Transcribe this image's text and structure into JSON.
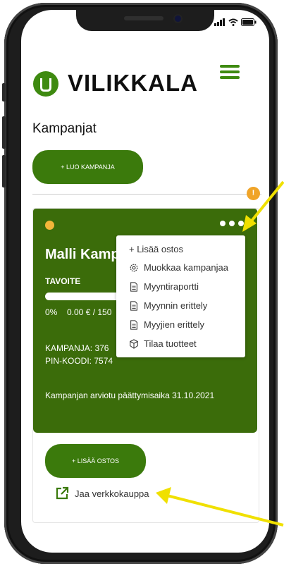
{
  "brand": {
    "name": "VILIKKALA",
    "color": "#3b6c0a"
  },
  "header": {
    "menu_icon": "hamburger-icon"
  },
  "page": {
    "title": "Kampanjat"
  },
  "create_button": {
    "label": "+ LUO KAMPANJA"
  },
  "notification": {
    "badge": "!"
  },
  "campaign": {
    "name": "Malli Kamp",
    "goal_label": "TAVOITE",
    "progress_percent_text": "0%",
    "progress_value": 0,
    "progress_amount": "0.00 € / 150",
    "campaign_id_text": "KAMPANJA: 376",
    "pin_text": "PIN-KOODI: 7574",
    "end_text": "Kampanjan arviotu päättymisaika 31.10.2021"
  },
  "menu": {
    "items": [
      {
        "label": "+ Lisää ostos",
        "icon": ""
      },
      {
        "label": "Muokkaa kampanjaa",
        "icon": "gear-icon"
      },
      {
        "label": "Myyntiraportti",
        "icon": "document-icon"
      },
      {
        "label": "Myynnin erittely",
        "icon": "document-icon"
      },
      {
        "label": "Myyjien erittely",
        "icon": "document-icon"
      },
      {
        "label": "Tilaa tuotteet",
        "icon": "box-icon"
      }
    ]
  },
  "add_purchase_button": {
    "label": "+ LISÄÄ OSTOS"
  },
  "share": {
    "label": "Jaa verkkokauppa",
    "icon": "external-link-icon"
  },
  "annotation": {
    "arrow_color": "#f0e000"
  }
}
